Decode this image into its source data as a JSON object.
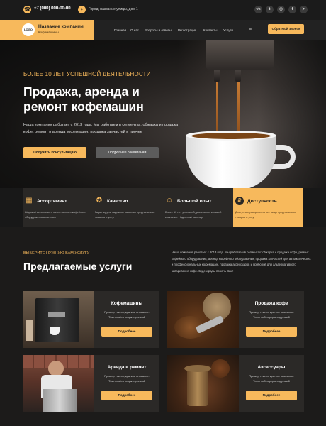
{
  "topbar": {
    "phone": "+7 (000) 000-00-00",
    "address": "Город, название улицы, дом 1",
    "phone_icon": "phone-icon",
    "address_icon": "map-pin-icon",
    "socials": [
      "vk",
      "twitter",
      "instagram",
      "facebook",
      "telegram"
    ]
  },
  "brand": {
    "logo_text": "LOGO",
    "company_name": "Название компании",
    "tagline": "Кофемашины"
  },
  "nav": {
    "items": [
      "Главная",
      "О нас",
      "Вопросы и ответы",
      "Регистрация",
      "Контакты",
      "Услуги"
    ],
    "menu_glyph": "≡",
    "callback_label": "Обратный звонок"
  },
  "hero": {
    "tag": "БОЛЕЕ 10 ЛЕТ УСПЕШНОЙ ДЕЯТЕЛЬНОСТИ",
    "title": "Продажа, аренда и ремонт кофемашин",
    "text": "Наша компания работает с 2013 года. Мы работаем в сегментах: обжарка и продажа кофе, ремонт и аренда кофемашин, продажа запчастей и прочее",
    "primary_button": "Получить консультацию",
    "secondary_button": "Подробнее о компании"
  },
  "features": [
    {
      "title": "Ассортимент",
      "icon": "store-icon",
      "text": "Широкий ассортимент качественного кофейного оборудования в наличии",
      "active": false
    },
    {
      "title": "Качество",
      "icon": "medal-icon",
      "text": "Гарантируем надежное качество предлагаемых товаров и услуг",
      "active": false
    },
    {
      "title": "Большой опыт",
      "icon": "experience-icon",
      "text": "Более 10 лет успешной деятельности нашей компании. Надежный партнер",
      "active": false
    },
    {
      "title": "Доступность",
      "icon": "piggy-bank-icon",
      "text": "Доступные расценки на все виды предлагаемых товаров и услуг",
      "active": true
    }
  ],
  "services": {
    "tag": "ВЫБЕРИТЕ НУЖНУЮ ВАМ УСЛУГУ",
    "title": "Предлагаемые услуги",
    "text": "Наша компания работает с 2013 года. Мы работаем в сегментах: обжарка и продажа кофе, ремонт кофейного оборудования, аренда кофейного оборудования, продажа запчастей для автоматических и профессиональных кофемашин, продажа аксессуаров и приборов для альтернативного заваривания кофе. Будем рады помочь Вам!",
    "cards": [
      {
        "title": "Кофемашины",
        "text": "Пример текста, краткое описание. Текст сайта редактируемый",
        "button": "Подробнее"
      },
      {
        "title": "Продажа кофе",
        "text": "Пример текста, краткое описание. Текст сайта редактируемый",
        "button": "Подробнее"
      },
      {
        "title": "Аренда и ремонт",
        "text": "Пример текста, краткое описание. Текст сайта редактируемый",
        "button": "Подробнее"
      },
      {
        "title": "Аксессуары",
        "text": "Пример текста, краткое описание. Текст сайта редактируемый",
        "button": "Подробнее"
      }
    ]
  },
  "colors": {
    "accent": "#f7b95c",
    "dark": "#1c1b1a",
    "card": "#2b2927"
  }
}
